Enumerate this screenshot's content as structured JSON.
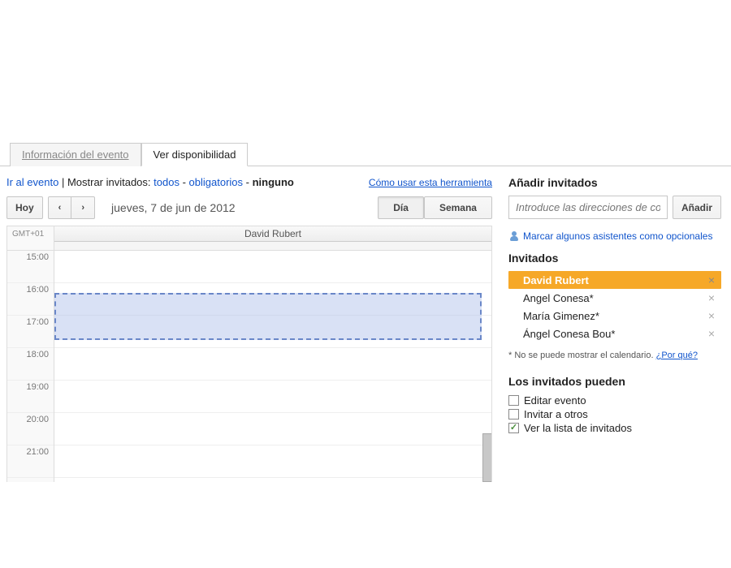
{
  "tabs": {
    "info": "Información del evento",
    "availability": "Ver disponibilidad"
  },
  "toolbar": {
    "go_to_event": "Ir al evento",
    "show_guests_label": "Mostrar invitados:",
    "show_all": "todos",
    "show_required": "obligatorios",
    "show_none": "ninguno",
    "help_link": "Cómo usar esta herramienta",
    "today": "Hoy",
    "prev": "‹",
    "next": "›",
    "date": "jueves, 7 de jun de 2012",
    "day": "Día",
    "week": "Semana"
  },
  "schedule": {
    "timezone": "GMT+01",
    "attendee_name": "David Rubert",
    "hours": [
      "15:00",
      "16:00",
      "17:00",
      "18:00",
      "19:00",
      "20:00",
      "21:00"
    ]
  },
  "right": {
    "add_guests_title": "Añadir invitados",
    "add_placeholder": "Introduce las direcciones de correo",
    "add_button": "Añadir",
    "mark_optional": "Marcar algunos asistentes como opcionales",
    "guests_title": "Invitados",
    "guests": [
      {
        "name": "David Rubert",
        "organizer": true,
        "note": ""
      },
      {
        "name": "Angel Conesa",
        "organizer": false,
        "note": "*"
      },
      {
        "name": "María Gimenez",
        "organizer": false,
        "note": "*"
      },
      {
        "name": "Ángel Conesa Bou",
        "organizer": false,
        "note": "*"
      }
    ],
    "footnote_text": "* No se puede mostrar el calendario.",
    "footnote_link": "¿Por qué?",
    "permissions_title": "Los invitados pueden",
    "perm_edit": "Editar evento",
    "perm_invite": "Invitar a otros",
    "perm_seelist": "Ver la lista de invitados"
  }
}
